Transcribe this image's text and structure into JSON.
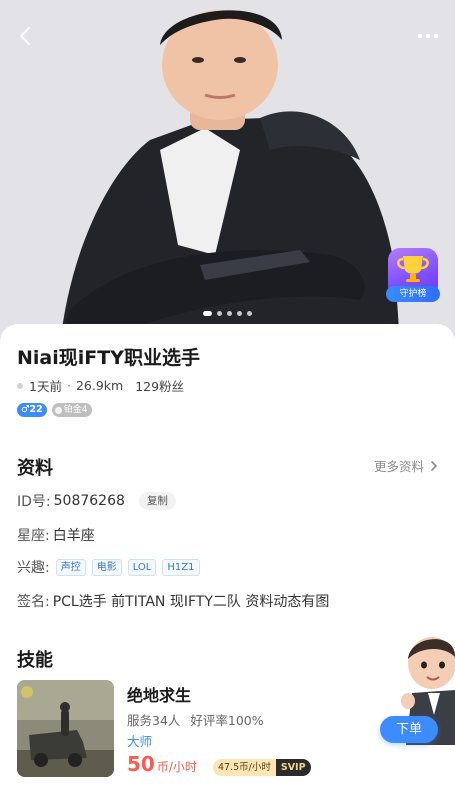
{
  "profile": {
    "name": "Niai现iFTY职业选手",
    "last_active": "1天前",
    "distance": "26.9km",
    "fans": "129粉丝",
    "gender_tag": "♂22",
    "level_tag": "铂金4"
  },
  "hero": {
    "guard_label": "守护榜",
    "carousel_count": 5,
    "carousel_active": 1
  },
  "info": {
    "title": "资料",
    "more_label": "更多资料",
    "id_label": "ID号:",
    "id_value": "50876268",
    "copy_label": "复制",
    "zodiac_label": "星座:",
    "zodiac_value": "白羊座",
    "interest_label": "兴趣:",
    "interests": [
      "声控",
      "电影",
      "LOL",
      "H1Z1"
    ],
    "signature_label": "签名:",
    "signature_value": "PCL选手 前TITAN 现IFTY二队 资料动态有图"
  },
  "skills": {
    "title": "技能",
    "items": [
      {
        "name": "绝地求生",
        "served": "服务34人",
        "rating": "好评率100%",
        "level": "大师",
        "price": "50",
        "unit": "币/小时",
        "svip_price": "47.5币/小时",
        "svip_label": "SVIP"
      }
    ]
  },
  "order_button": "下单",
  "colors": {
    "accent": "#3d8cff",
    "price": "#ff5a4e"
  },
  "icons": {
    "back": "chevron-left-icon",
    "more": "more-dots-icon",
    "guard": "trophy-icon",
    "more_info": "chevron-right-icon"
  }
}
